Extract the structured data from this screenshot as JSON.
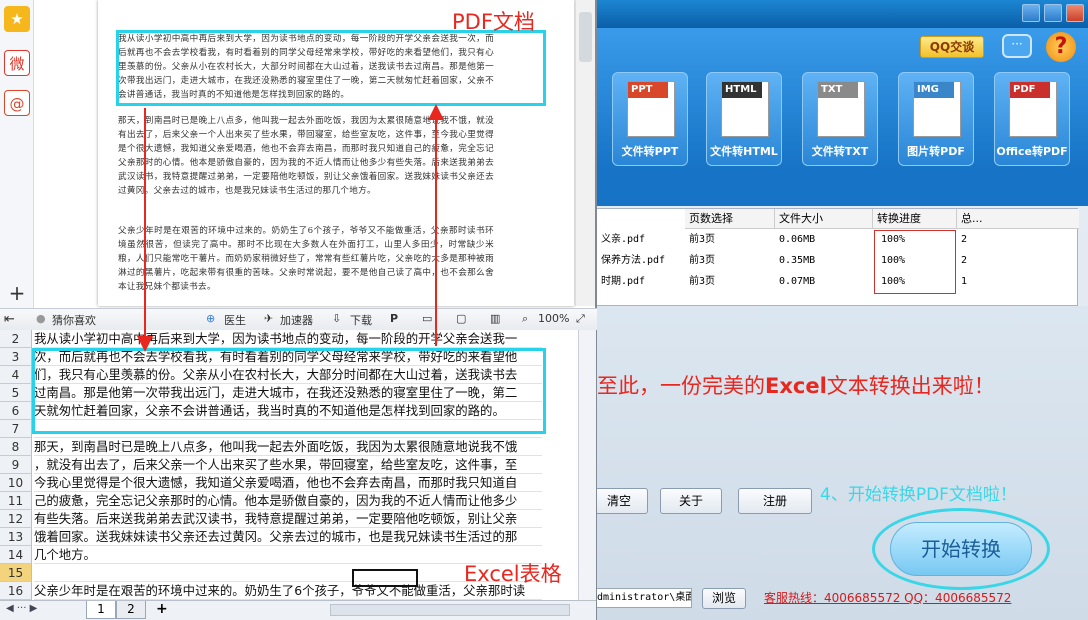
{
  "pdf_reader": {
    "sidebar": [
      {
        "name": "favorite-star-icon",
        "glyph": "★"
      },
      {
        "name": "weibo-icon",
        "glyph": "微"
      },
      {
        "name": "email-icon",
        "glyph": "@"
      }
    ],
    "add_glyph": "+",
    "paragraphs": [
      "我从读小学初中高中再后来到大学，因为读书地点的变动，每一阶段的开学父亲会送我一次，而后就再也不会去学校看我，有时看着别的同学父母经常来学校，带好吃的来看望他们，我只有心里羡慕的份。父亲从小在农村长大，大部分时间都在大山过着，送我读书去过南昌。那是他第一次带我出远门，走进大城市，在我还没熟悉的寝室里住了一晚，第二天就匆忙赶着回家，父亲不会讲普通话，我当时真的不知道他是怎样找到回家的路的。",
      "那天，到南昌时已是晚上八点多，他叫我一起去外面吃饭，我因为太累很随意地说我不饿，就没有出去了，后来父亲一个人出来买了些水果，带回寝室，给些室友吃，这件事，至今我心里觉得是个很大遗憾，我知道父亲爱喝酒，他也不会弃去南昌，而那时我只知道自己的疲惫，完全忘记父亲那时的心情。他本是骄傲自豪的，因为我的不近人情而让他多少有些失落。后来送我弟弟去武汉读书，我特意提醒过弟弟，一定要陪他吃顿饭，别让父亲饿着回家。送我妹妹读书父亲还去过黄冈。父亲去过的城市，也是我兄妹读书生活过的那几个地方。",
      "父亲少年时是在艰苦的环境中过来的。奶奶生了6个孩子，爷爷又不能做重活，父亲那时读书环境虽然很苦，但读完了高中。那时不比现在大多数人在外面打工，山里人多田少，时常缺少米粮，人们只能常吃干薯片。而奶奶家稍微好些了，常常有些红薯片吃，父亲吃的大多是那种被雨淋过的黑薯片，吃起来带有很重的苦味。父亲时常说起，要不是他自己读了高中，也不会那么舍本让我兄妹个都读书去。"
    ],
    "status": {
      "guess_like": "猜你喜欢",
      "doctor": "医生",
      "accelerator": "加速器",
      "download": "下载",
      "zoom": "100%"
    }
  },
  "excel": {
    "rows": [
      {
        "num": "2",
        "text": "我从读小学初中高中再后来到大学，因为读书地点的变动，每一阶段的开学父亲会送我一"
      },
      {
        "num": "3",
        "text": "次，而后就再也不会去学校看我，有时看着别的同学父母经常来学校，带好吃的来看望他"
      },
      {
        "num": "4",
        "text": "们，我只有心里羡慕的份。父亲从小在农村长大，大部分时间都在大山过着，送我读书去"
      },
      {
        "num": "5",
        "text": "过南昌。那是他第一次带我出远门，走进大城市，在我还没熟悉的寝室里住了一晚，第二"
      },
      {
        "num": "6",
        "text": "天就匆忙赶着回家，父亲不会讲普通话，我当时真的不知道他是怎样找到回家的路的。"
      },
      {
        "num": "7",
        "text": ""
      },
      {
        "num": "8",
        "text": "那天，到南昌时已是晚上八点多，他叫我一起去外面吃饭，我因为太累很随意地说我不饿"
      },
      {
        "num": "9",
        "text": "，就没有出去了，后来父亲一个人出来买了些水果，带回寝室，给些室友吃，这件事，至"
      },
      {
        "num": "10",
        "text": "今我心里觉得是个很大遗憾，我知道父亲爱喝酒，他也不会弃去南昌，而那时我只知道自"
      },
      {
        "num": "11",
        "text": "己的疲惫，完全忘记父亲那时的心情。他本是骄傲自豪的，因为我的不近人情而让他多少"
      },
      {
        "num": "12",
        "text": "有些失落。后来送我弟弟去武汉读书，我特意提醒过弟弟，一定要陪他吃顿饭，别让父亲"
      },
      {
        "num": "13",
        "text": "饿着回家。送我妹妹读书父亲还去过黄冈。父亲去过的城市，也是我兄妹读书生活过的那"
      },
      {
        "num": "14",
        "text": "几个地方。"
      },
      {
        "num": "15",
        "text": ""
      },
      {
        "num": "16",
        "text": "父亲少年时是在艰苦的环境中过来的。奶奶生了6个孩子，爷爷又不能做重活，父亲那时读"
      }
    ],
    "active_row": "15",
    "tabs": {
      "nav": "◀ ··· ▶",
      "sheet1": "1",
      "sheet2": "2",
      "add": "+"
    }
  },
  "converter": {
    "qq_exchange": "QQ交谈",
    "chat_glyph": "···",
    "help_glyph": "?",
    "tools": [
      {
        "tag": "PPT",
        "label": "文件转PPT",
        "color": "#d9472b"
      },
      {
        "tag": "HTML",
        "label": "文件转HTML",
        "color": "#333333"
      },
      {
        "tag": "TXT",
        "label": "文件转TXT",
        "color": "#8a8a8a"
      },
      {
        "tag": "IMG",
        "label": "图片转PDF",
        "color": "#3b86c8"
      },
      {
        "tag": "PDF",
        "label": "Office转PDF",
        "color": "#c9302c"
      }
    ],
    "table": {
      "headers": [
        "页数选择",
        "文件大小",
        "转换进度",
        "总..."
      ],
      "rows": [
        {
          "name": "义亲.pdf",
          "pages": "前3页",
          "size": "0.06MB",
          "progress": "100%",
          "total": "2"
        },
        {
          "name": "保养方法.pdf",
          "pages": "前3页",
          "size": "0.35MB",
          "progress": "100%",
          "total": "2"
        },
        {
          "name": "时期.pdf",
          "pages": "前3页",
          "size": "0.07MB",
          "progress": "100%",
          "total": "1"
        }
      ]
    },
    "buttons": {
      "clear": "清空",
      "about": "关于",
      "register": "注册",
      "browse": "浏览",
      "start": "开始转换"
    },
    "output_path": "dministrator\\桌面",
    "hotline": "客服热线：4006685572 QQ：4006685572"
  },
  "annotations": {
    "pdf_label": "PDF文档",
    "excel_label": "Excel表格",
    "done_prefix": "至此，一份完美的",
    "done_excel": "Excel",
    "done_suffix": "文本转换出来啦！",
    "step4": "4、开始转换PDF文档啦！"
  },
  "colors": {
    "annotation_red": "#e8271f",
    "highlight_cyan": "#27d3ea",
    "step_cyan": "#3ad7e8"
  }
}
